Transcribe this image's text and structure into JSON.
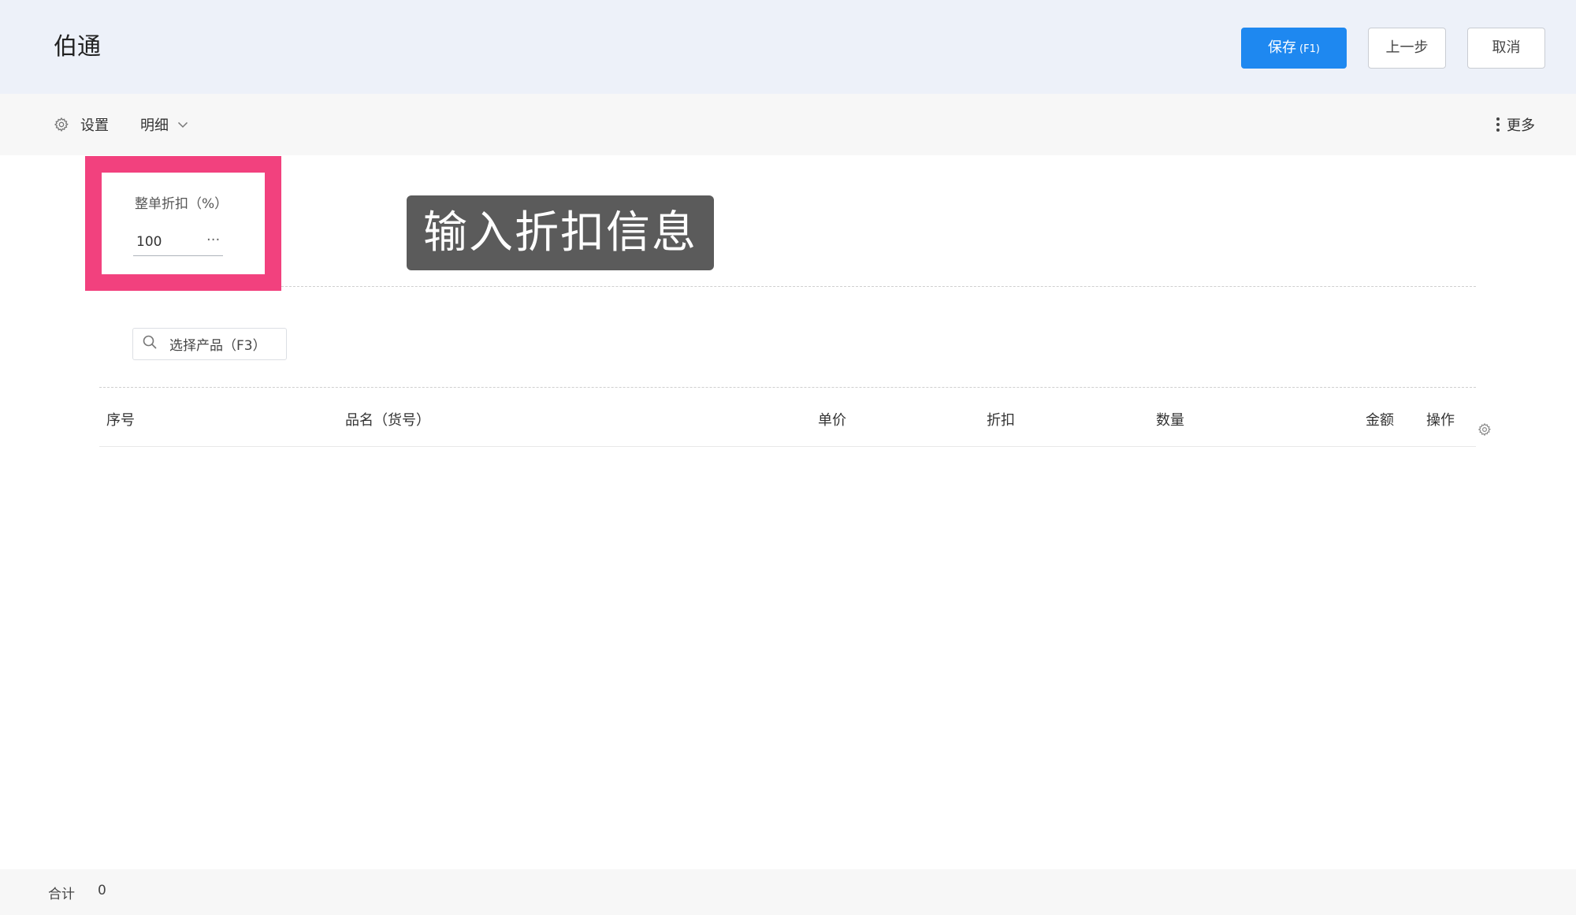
{
  "header": {
    "title": "伯通",
    "save_label": "保存",
    "save_hint": "(F1)",
    "prev_label": "上一步",
    "cancel_label": "取消",
    "accent_color": "#1e88f0"
  },
  "toolbar": {
    "settings_icon": "gear-icon",
    "settings_label": "设置",
    "detail_label": "明细",
    "detail_icon": "chevron-down-icon",
    "more_icon": "vertical-dots-icon",
    "more_label": "更多"
  },
  "discount": {
    "label": "整单折扣（%）",
    "value": "100",
    "more": "···",
    "highlight_color": "#f2417e"
  },
  "tooltip": {
    "text": "输入折扣信息"
  },
  "product_search": {
    "icon": "search-icon",
    "placeholder": "选择产品（F3）"
  },
  "table": {
    "columns": [
      "序号",
      "品名（货号）",
      "单价",
      "折扣",
      "数量",
      "金额",
      "操作"
    ],
    "settings_icon": "gear-icon",
    "rows": []
  },
  "footer": {
    "total_label": "合计",
    "total_value": "0"
  }
}
